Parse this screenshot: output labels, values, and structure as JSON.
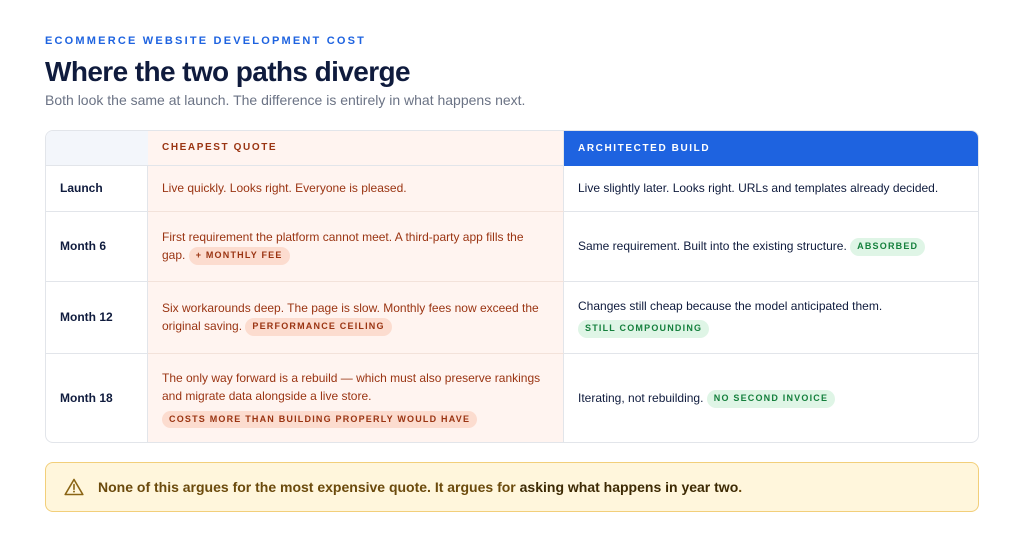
{
  "header": {
    "eyebrow": "ECOMMERCE WEBSITE DEVELOPMENT COST",
    "title": "Where the two paths diverge",
    "subtitle": "Both look the same at launch. The difference is entirely in what happens next."
  },
  "table": {
    "col_cheap": "CHEAPEST QUOTE",
    "col_arch": "ARCHITECTED BUILD",
    "rows": [
      {
        "label": "Launch",
        "cheap": "Live quickly. Looks right. Everyone is pleased.",
        "cheap_tag": "",
        "arch": "Live slightly later. Looks right. URLs and templates already decided.",
        "arch_tag": ""
      },
      {
        "label": "Month 6",
        "cheap": "First requirement the platform cannot meet. A third-party app fills the gap.",
        "cheap_tag": "+ MONTHLY FEE",
        "arch": "Same requirement. Built into the existing structure.",
        "arch_tag": "ABSORBED"
      },
      {
        "label": "Month 12",
        "cheap": "Six workarounds deep. The page is slow. Monthly fees now exceed the original saving.",
        "cheap_tag": "PERFORMANCE CEILING",
        "arch": "Changes still cheap because the model anticipated them.",
        "arch_tag": "STILL COMPOUNDING"
      },
      {
        "label": "Month 18",
        "cheap": "The only way forward is a rebuild — which must also preserve rankings and migrate data alongside a live store.",
        "cheap_tag": "COSTS MORE THAN BUILDING PROPERLY WOULD HAVE",
        "arch": "Iterating, not rebuilding.",
        "arch_tag": "NO SECOND INVOICE"
      }
    ]
  },
  "callout": {
    "icon": "warning-icon",
    "text_prefix": "None of this argues for the most expensive quote. It argues for ",
    "text_strong": "asking what happens in year two",
    "text_suffix": "."
  },
  "colors": {
    "accent": "#1e63e0",
    "cheap_text": "#9a3412",
    "cheap_bg": "#fff4f0",
    "good_tag": "#15803d",
    "callout_bg": "#fff6dc"
  }
}
